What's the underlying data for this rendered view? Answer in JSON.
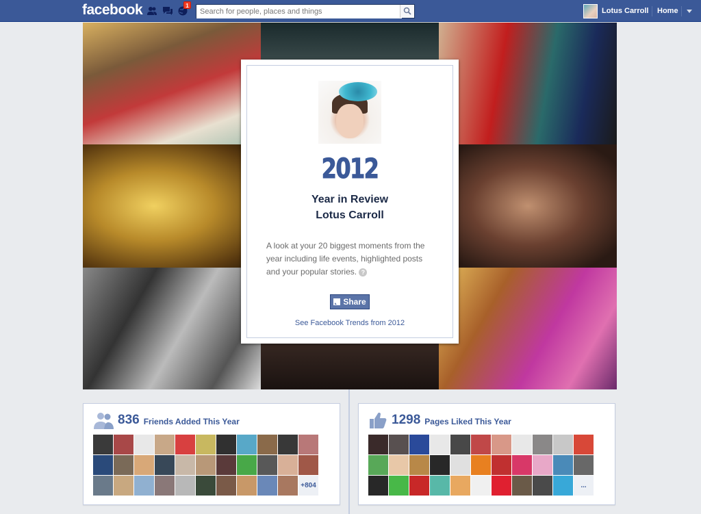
{
  "topbar": {
    "logo": "facebook",
    "notification_count": "1",
    "search_placeholder": "Search for people, places and things",
    "user_name": "Lotus Carroll",
    "home_label": "Home"
  },
  "review": {
    "year": "2012",
    "title_line1": "Year in Review",
    "title_line2": "Lotus Carroll",
    "description": "A look at your 20 biggest moments from the year including life events, highlighted posts and your popular stories.",
    "help_glyph": "?",
    "share_label": "Share",
    "trends_link": "See Facebook Trends from 2012"
  },
  "friends_box": {
    "count": "836",
    "label": "Friends Added This Year",
    "more_label": "+804",
    "thumb_colors": [
      "#3a3a3a",
      "#a84848",
      "#e8e8e8",
      "#c8a888",
      "#d84040",
      "#c8b860",
      "#303030",
      "#58a8c8",
      "#8a6a4a",
      "#383838",
      "#b87878",
      "#2a4a7a",
      "#7a6a58",
      "#d8a878",
      "#384858",
      "#c8b8a8",
      "#b89878",
      "#5a3a3a",
      "#48a848",
      "#585858",
      "#d8b098",
      "#a05848",
      "#6a7a8a",
      "#c8a880",
      "#90b0d0",
      "#8a7878",
      "#b8b8b8",
      "#3a4a3a",
      "#7a5a48",
      "#c89868",
      "#6a88b8",
      "#a87860"
    ]
  },
  "pages_box": {
    "count": "1298",
    "label": "Pages Liked This Year",
    "more_label": "...",
    "thumb_colors": [
      "#3a2a2a",
      "#585050",
      "#2a4a9a",
      "#e8e8e8",
      "#484848",
      "#c04848",
      "#d89888",
      "#e8e8e8",
      "#8a8888",
      "#c8c8c8",
      "#d84838",
      "#58a858",
      "#e8c8a8",
      "#b88848",
      "#282828",
      "#e0e0e0",
      "#e88020",
      "#c03030",
      "#d83868",
      "#e8a8c8",
      "#4a8ab8",
      "#686868",
      "#282828",
      "#48b848",
      "#c82828",
      "#58b8a8",
      "#e8a860",
      "#f0f0f0",
      "#e02030",
      "#6a5a48",
      "#4a4a4a",
      "#38a8d8"
    ]
  }
}
